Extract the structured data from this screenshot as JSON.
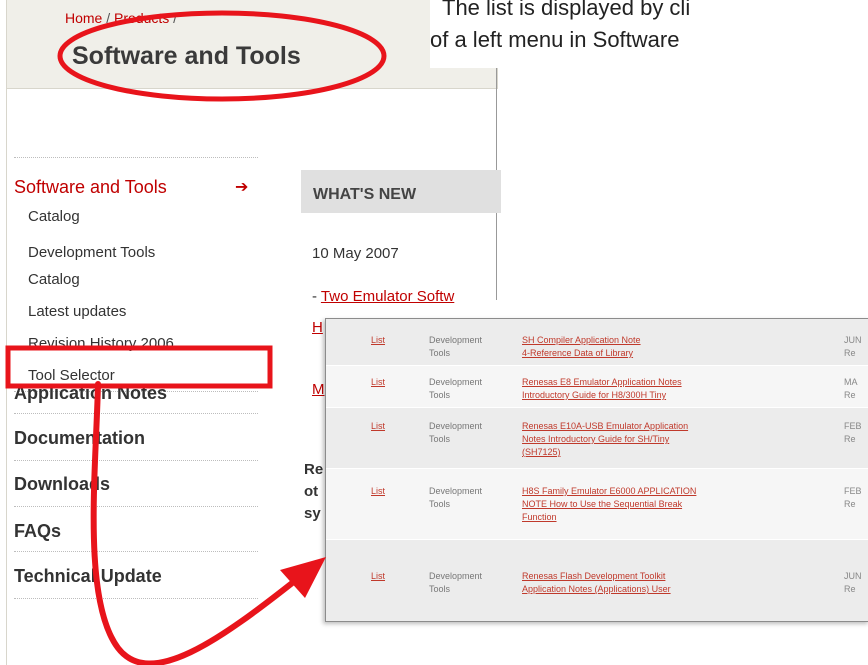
{
  "breadcrumb": {
    "home": "Home",
    "products": "Products",
    "sep": "/"
  },
  "page_title": "Software and Tools",
  "caption": {
    "line1": "The list is displayed by cli",
    "line2": "of a left menu in Software"
  },
  "left_menu": {
    "section_label": "Software and Tools",
    "section_arrow": "➔",
    "sub_items": [
      "Catalog",
      "Development Tools",
      "Catalog",
      "Latest updates",
      "Revision History 2006",
      "Tool Selector"
    ],
    "main_items": [
      "Application Notes",
      "Documentation",
      "Downloads",
      "FAQs",
      "Technical Update"
    ]
  },
  "whats_new": {
    "title": "WHAT'S NEW",
    "date": "10 May 2007",
    "link_prefix": "- ",
    "link_text": "Two Emulator Softw",
    "frag_H": "H",
    "frag_M": "M",
    "frag_re": "Re",
    "frag_ot": "ot",
    "frag_sy": "sy"
  },
  "inset_rows": [
    {
      "link": "List",
      "category": [
        "Development",
        "Tools"
      ],
      "title": [
        "SH Compiler Application Note",
        "4-Reference Data of Library"
      ],
      "date": [
        "JUN",
        "Re"
      ]
    },
    {
      "link": "List",
      "category": [
        "Development",
        "Tools"
      ],
      "title": [
        "Renesas E8 Emulator Application Notes",
        "Introductory Guide for H8/300H Tiny"
      ],
      "date": [
        "MA",
        "Re"
      ]
    },
    {
      "link": "List",
      "category": [
        "Development",
        "Tools"
      ],
      "title": [
        "Renesas E10A-USB Emulator Application",
        "Notes Introductory Guide for SH/Tiny",
        "(SH7125)"
      ],
      "date": [
        "FEB",
        "Re"
      ]
    },
    {
      "link": "List",
      "category": [
        "Development",
        "Tools"
      ],
      "title": [
        "H8S Family Emulator E6000 APPLICATION",
        "NOTE How to Use the Sequential Break",
        "Function"
      ],
      "date": [
        "FEB",
        "Re"
      ]
    },
    {
      "link": "List",
      "category": [
        "Development",
        "Tools"
      ],
      "title": [
        "Renesas Flash Development Toolkit",
        "Application Notes (Applications) User"
      ],
      "date": [
        "JUN",
        "Re"
      ]
    }
  ],
  "colors": {
    "accent_red": "#c00000",
    "annotation_red": "#e8141b",
    "header_bg": "#f0efe9"
  }
}
